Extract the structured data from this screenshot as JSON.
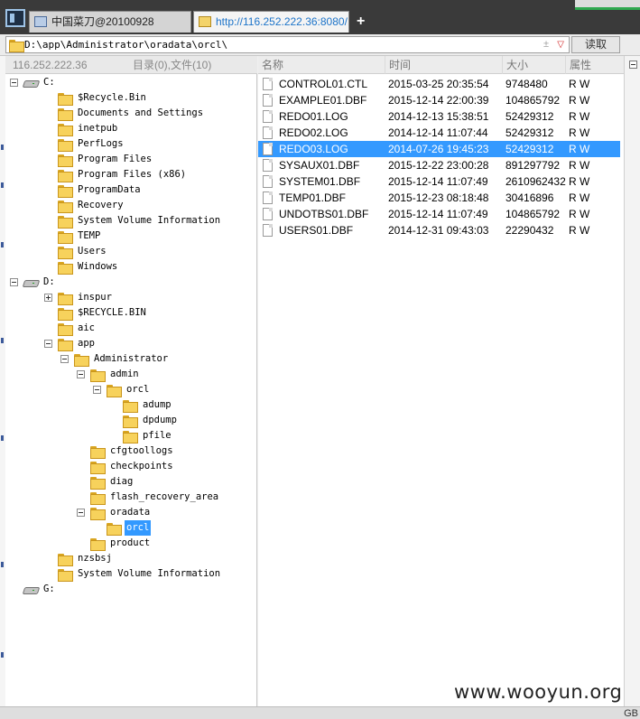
{
  "tabs": [
    {
      "label": "中国菜刀@20100928",
      "active": false
    },
    {
      "label": "http://116.252.222.36:8080/...",
      "active": true
    }
  ],
  "new_tab_label": "+",
  "address": {
    "path": "D:\\app\\Administrator\\oradata\\orcl\\",
    "read_button": "读取"
  },
  "left_header": {
    "ip": "116.252.222.36",
    "counts": "目录(0),文件(10)"
  },
  "columns": {
    "name": "名称",
    "time": "时间",
    "size": "大小",
    "attr": "属性"
  },
  "tree": [
    {
      "label": "C:",
      "type": "drive",
      "level": 0,
      "toggle": "minus"
    },
    {
      "label": "$Recycle.Bin",
      "type": "folder",
      "level": 1
    },
    {
      "label": "Documents and Settings",
      "type": "folder",
      "level": 1
    },
    {
      "label": "inetpub",
      "type": "folder",
      "level": 1
    },
    {
      "label": "PerfLogs",
      "type": "folder",
      "level": 1
    },
    {
      "label": "Program Files",
      "type": "folder",
      "level": 1
    },
    {
      "label": "Program Files (x86)",
      "type": "folder",
      "level": 1
    },
    {
      "label": "ProgramData",
      "type": "folder",
      "level": 1
    },
    {
      "label": "Recovery",
      "type": "folder",
      "level": 1
    },
    {
      "label": "System Volume Information",
      "type": "folder",
      "level": 1
    },
    {
      "label": "TEMP",
      "type": "folder",
      "level": 1
    },
    {
      "label": "Users",
      "type": "folder",
      "level": 1
    },
    {
      "label": "Windows",
      "type": "folder",
      "level": 1
    },
    {
      "label": "D:",
      "type": "drive",
      "level": 0,
      "toggle": "minus"
    },
    {
      "label": "inspur",
      "type": "folder",
      "level": 1,
      "toggle": "plus"
    },
    {
      "label": "$RECYCLE.BIN",
      "type": "folder",
      "level": 1
    },
    {
      "label": "aic",
      "type": "folder",
      "level": 1
    },
    {
      "label": "app",
      "type": "folder",
      "level": 1,
      "toggle": "minus"
    },
    {
      "label": "Administrator",
      "type": "folder",
      "level": 2,
      "toggle": "minus"
    },
    {
      "label": "admin",
      "type": "folder",
      "level": 3,
      "toggle": "minus"
    },
    {
      "label": "orcl",
      "type": "folder",
      "level": 4,
      "toggle": "minus"
    },
    {
      "label": "adump",
      "type": "folder",
      "level": 5
    },
    {
      "label": "dpdump",
      "type": "folder",
      "level": 5
    },
    {
      "label": "pfile",
      "type": "folder",
      "level": 5
    },
    {
      "label": "cfgtoollogs",
      "type": "folder",
      "level": 3
    },
    {
      "label": "checkpoints",
      "type": "folder",
      "level": 3
    },
    {
      "label": "diag",
      "type": "folder",
      "level": 3
    },
    {
      "label": "flash_recovery_area",
      "type": "folder",
      "level": 3
    },
    {
      "label": "oradata",
      "type": "folder",
      "level": 3,
      "toggle": "minus"
    },
    {
      "label": "orcl",
      "type": "folder",
      "level": 4,
      "selected": true
    },
    {
      "label": "product",
      "type": "folder",
      "level": 3
    },
    {
      "label": "nzsbsj",
      "type": "folder",
      "level": 1
    },
    {
      "label": "System Volume Information",
      "type": "folder",
      "level": 1
    },
    {
      "label": "G:",
      "type": "drive",
      "level": 0
    }
  ],
  "files": [
    {
      "name": "CONTROL01.CTL",
      "time": "2015-03-25 20:35:54",
      "size": "9748480",
      "attr": "R W"
    },
    {
      "name": "EXAMPLE01.DBF",
      "time": "2015-12-14 22:00:39",
      "size": "104865792",
      "attr": "R W"
    },
    {
      "name": "REDO01.LOG",
      "time": "2014-12-13 15:38:51",
      "size": "52429312",
      "attr": "R W"
    },
    {
      "name": "REDO02.LOG",
      "time": "2014-12-14 11:07:44",
      "size": "52429312",
      "attr": "R W"
    },
    {
      "name": "REDO03.LOG",
      "time": "2014-07-26 19:45:23",
      "size": "52429312",
      "attr": "R W",
      "selected": true
    },
    {
      "name": "SYSAUX01.DBF",
      "time": "2015-12-22 23:00:28",
      "size": "891297792",
      "attr": "R W"
    },
    {
      "name": "SYSTEM01.DBF",
      "time": "2015-12-14 11:07:49",
      "size": "2610962432",
      "attr": "R W"
    },
    {
      "name": "TEMP01.DBF",
      "time": "2015-12-23 08:18:48",
      "size": "30416896",
      "attr": "R W"
    },
    {
      "name": "UNDOTBS01.DBF",
      "time": "2015-12-14 11:07:49",
      "size": "104865792",
      "attr": "R W"
    },
    {
      "name": "USERS01.DBF",
      "time": "2014-12-31 09:43:03",
      "size": "22290432",
      "attr": "R W"
    }
  ],
  "status": {
    "encoding": "GB"
  },
  "watermark": "www.wooyun.org",
  "colors": {
    "selection": "#3399ff",
    "folder": "#f7d25c",
    "tabbar": "#3a3a3a"
  }
}
